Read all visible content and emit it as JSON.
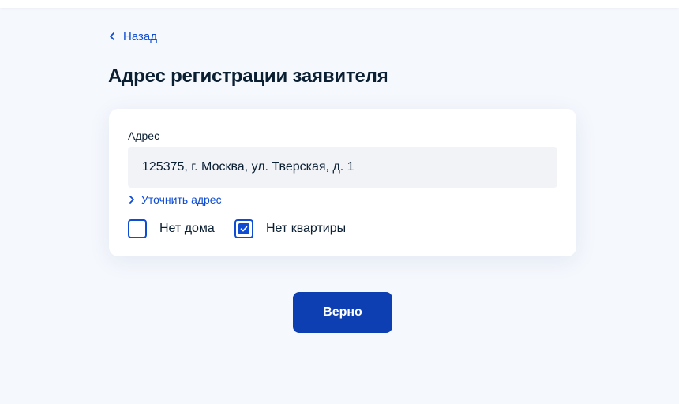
{
  "nav": {
    "back_label": "Назад",
    "back_icon": "chevron-left-icon"
  },
  "page": {
    "title": "Адрес регистрации заявителя"
  },
  "form": {
    "address_label": "Адрес",
    "address_value": "125375, г. Москва, ул. Тверская, д. 1",
    "refine_label": "Уточнить адрес",
    "refine_icon": "chevron-right-icon",
    "checkboxes": [
      {
        "label": "Нет дома",
        "checked": false
      },
      {
        "label": "Нет квартиры",
        "checked": true
      }
    ]
  },
  "actions": {
    "submit_label": "Верно"
  },
  "colors": {
    "accent": "#0d4cd3",
    "button": "#0d3fb2",
    "text": "#0b1f33",
    "background": "#f5f8fd",
    "input_background": "#f1f3f7"
  }
}
